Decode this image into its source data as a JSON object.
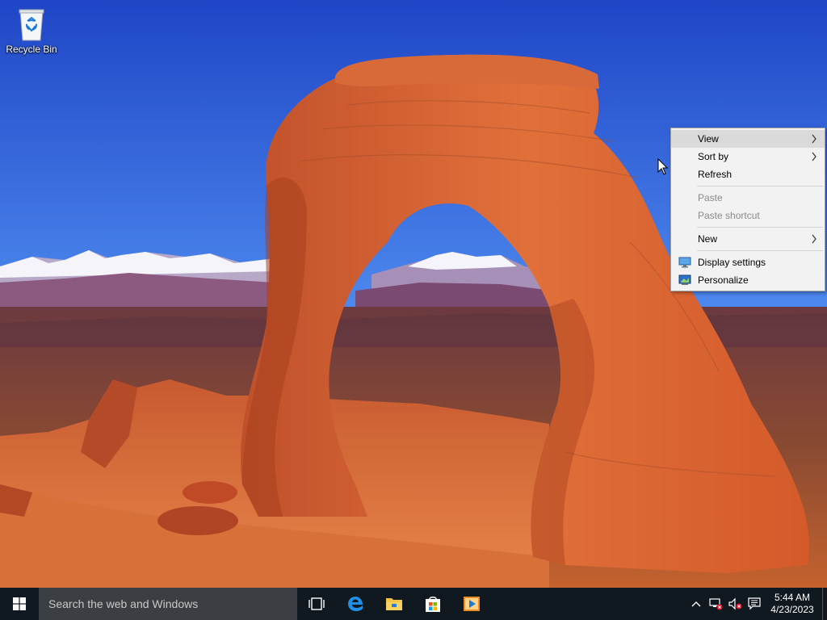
{
  "desktop": {
    "icons": [
      {
        "label": "Recycle Bin",
        "icon": "recycle-bin-icon"
      }
    ]
  },
  "context_menu": {
    "items": [
      {
        "label": "View",
        "state": "highlighted",
        "submenu": true
      },
      {
        "label": "Sort by",
        "state": "enabled",
        "submenu": true
      },
      {
        "label": "Refresh",
        "state": "enabled",
        "submenu": false
      },
      {
        "label": "Paste",
        "state": "disabled",
        "submenu": false
      },
      {
        "label": "Paste shortcut",
        "state": "disabled",
        "submenu": false
      },
      {
        "label": "New",
        "state": "enabled",
        "submenu": true
      },
      {
        "label": "Display settings",
        "state": "enabled",
        "icon": "display-settings-icon"
      },
      {
        "label": "Personalize",
        "state": "enabled",
        "icon": "personalize-icon"
      }
    ]
  },
  "taskbar": {
    "start_icon": "windows-logo-icon",
    "search_placeholder": "Search the web and Windows",
    "pinned": [
      {
        "name": "task-view",
        "icon": "task-view-icon"
      },
      {
        "name": "edge",
        "icon": "edge-icon"
      },
      {
        "name": "file-explorer",
        "icon": "file-explorer-icon"
      },
      {
        "name": "store",
        "icon": "store-icon"
      },
      {
        "name": "media-player",
        "icon": "media-player-icon"
      }
    ],
    "tray": {
      "icons": [
        "chevron-up-icon",
        "network-error-icon",
        "volume-muted-icon",
        "action-center-icon"
      ],
      "time": "5:44 AM",
      "date": "4/23/2023"
    }
  },
  "colors": {
    "taskbar": "#101820",
    "search_box": "#3b3f44",
    "menu_bg": "#f2f2f2",
    "menu_highlight": "#dadada",
    "accent_blue": "#1e7ad7"
  }
}
